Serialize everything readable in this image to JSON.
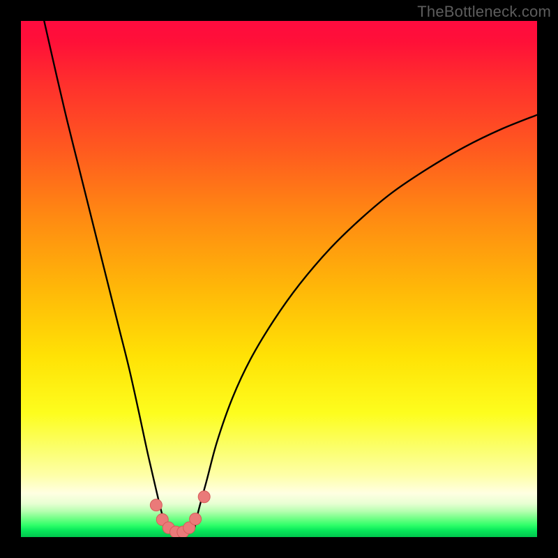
{
  "watermark": "TheBottleneck.com",
  "colors": {
    "frame": "#000000",
    "curve": "#000000",
    "marker_fill": "#ea7a79",
    "marker_stroke": "#d65b59"
  },
  "chart_data": {
    "type": "line",
    "title": "",
    "xlabel": "",
    "ylabel": "",
    "xlim": [
      0,
      100
    ],
    "ylim": [
      0,
      100
    ],
    "grid": false,
    "legend": false,
    "series": [
      {
        "name": "curve-left",
        "x": [
          4.5,
          7,
          9,
          11,
          13,
          15,
          17,
          19,
          21,
          23,
          24.5,
          26,
          27.2,
          28.2
        ],
        "values": [
          100,
          89,
          80.5,
          72.5,
          64.5,
          56.5,
          48.5,
          40.5,
          32.5,
          23.5,
          16.5,
          10,
          5,
          1.6
        ]
      },
      {
        "name": "curve-right",
        "x": [
          33.6,
          34.5,
          36,
          38,
          41,
          44.5,
          49,
          54,
          60,
          66,
          72,
          79,
          86,
          93,
          100
        ],
        "values": [
          1.6,
          5.5,
          11,
          18.5,
          27,
          34.5,
          42,
          49,
          56,
          61.8,
          66.8,
          71.5,
          75.6,
          79,
          81.8
        ]
      }
    ],
    "markers": {
      "name": "bottom-dots",
      "x": [
        26.2,
        27.4,
        28.6,
        30.0,
        31.4,
        32.6,
        33.8,
        35.5
      ],
      "values": [
        6.2,
        3.4,
        1.8,
        1.0,
        1.0,
        1.8,
        3.5,
        7.8
      ]
    }
  }
}
